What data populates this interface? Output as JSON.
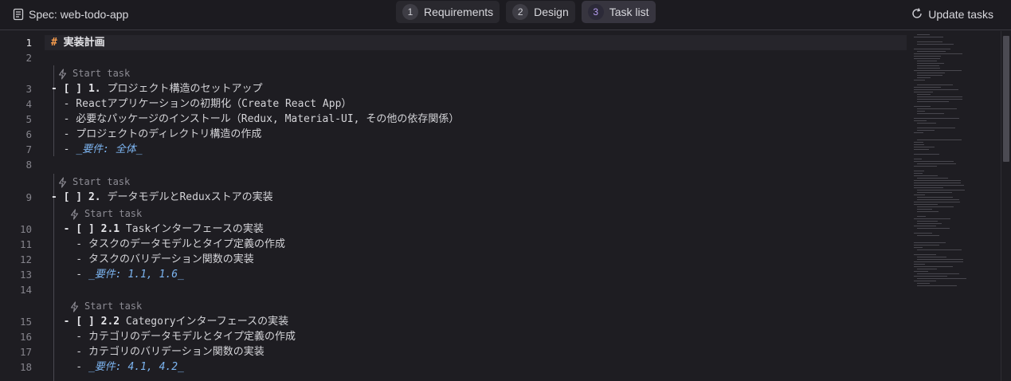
{
  "header": {
    "spec_title": "Spec: web-todo-app",
    "steps": [
      {
        "num": "1",
        "label": "Requirements"
      },
      {
        "num": "2",
        "label": "Design"
      },
      {
        "num": "3",
        "label": "Task list"
      }
    ],
    "update_label": "Update tasks"
  },
  "editor": {
    "codelens_label": "Start task",
    "line_numbers": [
      "1",
      "2",
      "3",
      "4",
      "5",
      "6",
      "7",
      "8",
      "9",
      "10",
      "11",
      "12",
      "13",
      "14",
      "15",
      "16",
      "17",
      "18"
    ],
    "lines": {
      "l1_hash": "#",
      "l1_text": " 実装計画",
      "l3_box": "- [ ] ",
      "l3_num": "1.",
      "l3_text": " プロジェクト構造のセットアップ",
      "l4": "  - Reactアプリケーションの初期化（Create React App）",
      "l5": "  - 必要なパッケージのインストール（Redux, Material-UI, その他の依存関係）",
      "l6": "  - プロジェクトのディレクトリ構造の作成",
      "l7_dash": "  - ",
      "l7_em": "_要件: 全体_",
      "l9_box": "- [ ] ",
      "l9_num": "2.",
      "l9_text": " データモデルとReduxストアの実装",
      "l10_box": "  - [ ] ",
      "l10_num": "2.1",
      "l10_text": " Taskインターフェースの実装",
      "l11": "    - タスクのデータモデルとタイプ定義の作成",
      "l12": "    - タスクのバリデーション関数の実装",
      "l13_dash": "    - ",
      "l13_em": "_要件: 1.1, 1.6_",
      "l15_box": "  - [ ] ",
      "l15_num": "2.2",
      "l15_text": " Categoryインターフェースの実装",
      "l16": "    - カテゴリのデータモデルとタイプ定義の作成",
      "l17": "    - カテゴリのバリデーション関数の実装",
      "l18_dash": "    - ",
      "l18_em": "_要件: 4.1, 4.2_"
    }
  },
  "colors": {
    "accent": "#b69cf2",
    "heading_hash": "#f39a4d",
    "emphasis": "#7cb4f0",
    "background": "#1e1d22"
  },
  "icons": {
    "spec": "document-icon",
    "codelens": "lightning-icon",
    "update": "refresh-icon"
  }
}
